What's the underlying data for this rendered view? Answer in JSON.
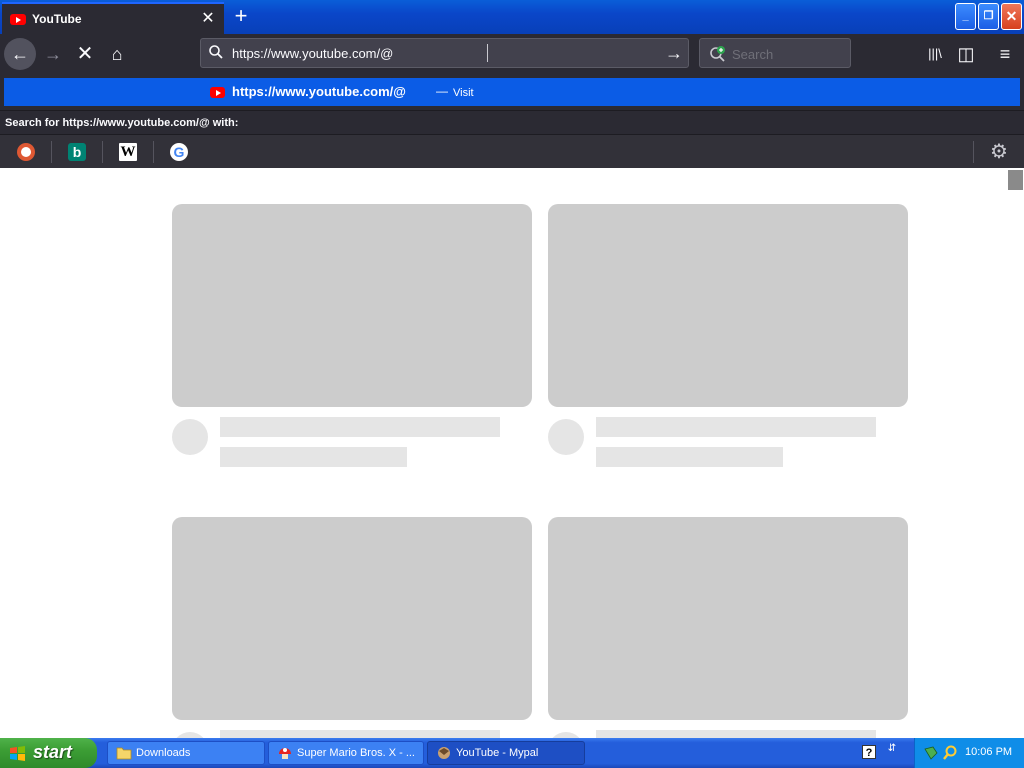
{
  "window": {
    "tab_title": "YouTube",
    "tab_close": "✕",
    "new_tab": "+",
    "min": "_",
    "max": "❐",
    "close": "✕"
  },
  "nav": {
    "back": "←",
    "forward": "→",
    "stop": "✕",
    "home": "⌂",
    "url": "https://www.youtube.com/@",
    "go": "→",
    "search_placeholder": "Search",
    "library": "|||\\",
    "sidebar": "◫",
    "menu": "≡"
  },
  "dropdown": {
    "suggestion_url": "https://www.youtube.com/@",
    "suggestion_sep": "—",
    "suggestion_action": "Visit",
    "search_with": "Search for https://www.youtube.com/@ with:",
    "engines": [
      "duckduckgo-icon",
      "bing-icon",
      "wikipedia-icon",
      "google-icon"
    ],
    "bing_letter": "b",
    "wiki_letter": "W",
    "google_letter": "G",
    "settings": "⚙"
  },
  "content": {
    "skeleton_cards": 4
  },
  "taskbar": {
    "start": "start",
    "tasks": [
      {
        "label": "Downloads"
      },
      {
        "label": "Super Mario Bros. X - ..."
      },
      {
        "label": "YouTube - Mypal"
      }
    ],
    "help": "?",
    "clock": "10:06 PM"
  },
  "colors": {
    "tab_active": "#2b2a33",
    "suggestion_highlight": "#0b5ce6",
    "skeleton_thumb": "#cccccc",
    "skeleton_line": "#e5e5e5",
    "xp_blue": "#245edb",
    "xp_start_green": "#3c9e35"
  }
}
